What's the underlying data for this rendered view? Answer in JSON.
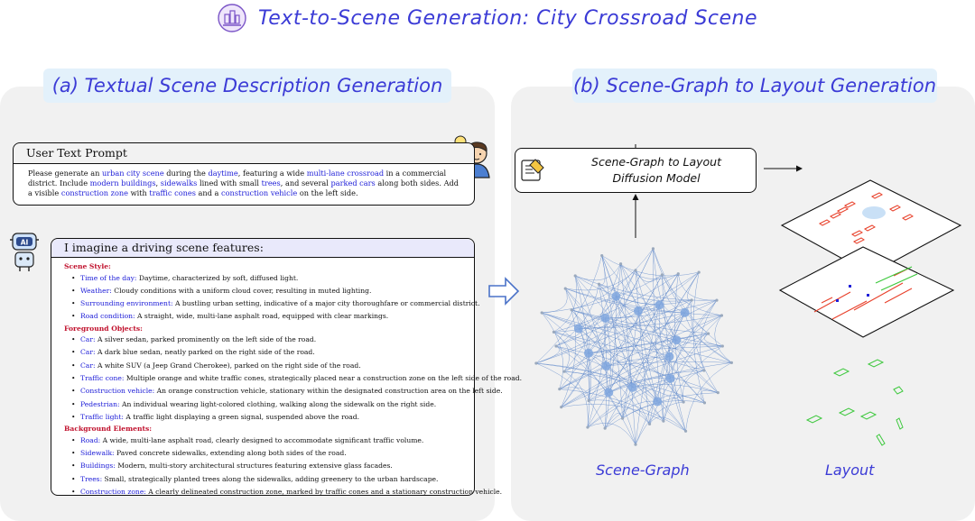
{
  "title": "Text-to-Scene Generation: City Crossroad Scene",
  "panel_a": {
    "header": "(a) Textual Scene Description Generation",
    "prompt": {
      "header": "User Text Prompt",
      "segments": [
        {
          "t": "Please generate an ",
          "h": false
        },
        {
          "t": "urban city scene",
          "h": true
        },
        {
          "t": " during the ",
          "h": false
        },
        {
          "t": "daytime",
          "h": true
        },
        {
          "t": ", featuring a wide ",
          "h": false
        },
        {
          "t": "multi-lane crossroad",
          "h": true
        },
        {
          "t": " in a commercial district. Include ",
          "h": false
        },
        {
          "t": "modern buildings",
          "h": true
        },
        {
          "t": ", ",
          "h": false
        },
        {
          "t": "sidewalks",
          "h": true
        },
        {
          "t": " lined with small ",
          "h": false
        },
        {
          "t": "trees",
          "h": true
        },
        {
          "t": ", and several ",
          "h": false
        },
        {
          "t": "parked cars",
          "h": true
        },
        {
          "t": " along both sides.  Add a visible ",
          "h": false
        },
        {
          "t": "construction zone",
          "h": true
        },
        {
          "t": " with ",
          "h": false
        },
        {
          "t": "traffic cones",
          "h": true
        },
        {
          "t": " and a ",
          "h": false
        },
        {
          "t": "construction vehicle",
          "h": true
        },
        {
          "t": " on the left side.",
          "h": false
        }
      ]
    },
    "description": {
      "header": "I imagine a driving scene features:",
      "sections": [
        {
          "title": "Scene Style:",
          "items": [
            {
              "key": "Time of the day:",
              "text": " Daytime, characterized by soft, diffused light."
            },
            {
              "key": "Weather:",
              "text": " Cloudy conditions with a uniform cloud cover, resulting in muted lighting."
            },
            {
              "key": "Surrounding environment:",
              "text": " A bustling urban setting, indicative of a major city thoroughfare or commercial district."
            },
            {
              "key": "Road condition:",
              "text": " A straight, wide, multi-lane asphalt road, equipped with clear markings."
            }
          ]
        },
        {
          "title": "Foreground Objects:",
          "items": [
            {
              "key": "Car:",
              "text": " A silver sedan, parked prominently on the left side of the road."
            },
            {
              "key": "Car:",
              "text": " A dark blue sedan, neatly parked on the right side of the road."
            },
            {
              "key": "Car:",
              "text": " A white SUV (a Jeep Grand Cherokee), parked on the right side of the road."
            },
            {
              "key": "Traffic cone:",
              "text": " Multiple orange and white traffic cones, strategically placed near a construction zone on the left side of the road."
            },
            {
              "key": "Construction vehicle:",
              "text": " An orange construction vehicle, stationary within the designated construction area on the left side."
            },
            {
              "key": "Pedestrian:",
              "text": " An individual wearing light-colored clothing, walking along the sidewalk on the right side."
            },
            {
              "key": "Traffic light:",
              "text": " A traffic light displaying a green signal, suspended above the road."
            }
          ]
        },
        {
          "title": "Background Elements:",
          "items": [
            {
              "key": "Road:",
              "text": " A wide, multi-lane asphalt road, clearly designed to accommodate significant traffic volume."
            },
            {
              "key": "Sidewalk:",
              "text": " Paved concrete sidewalks, extending along both sides of the road."
            },
            {
              "key": "Buildings:",
              "text": " Modern, multi-story architectural structures featuring extensive glass facades."
            },
            {
              "key": "Trees:",
              "text": " Small, strategically planted trees along the sidewalks, adding greenery to the urban hardscape."
            },
            {
              "key": "Construction zone:",
              "text": " A clearly delineated construction zone, marked by traffic cones and a stationary construction vehicle."
            }
          ]
        }
      ]
    },
    "robot_label": "AI"
  },
  "panel_b": {
    "header": "(b) Scene-Graph to Layout Generation",
    "model_label_line1": "Scene-Graph to Layout",
    "model_label_line2": "Diffusion Model",
    "graph_caption": "Scene-Graph",
    "layout_caption": "Layout"
  },
  "colors": {
    "accent": "#3b3bd6",
    "highlight": "#2020d8",
    "section": "#c0102c",
    "graph_edge": "#5b86c9",
    "layout_red": "#e8402a",
    "layout_green": "#3cc83c"
  }
}
